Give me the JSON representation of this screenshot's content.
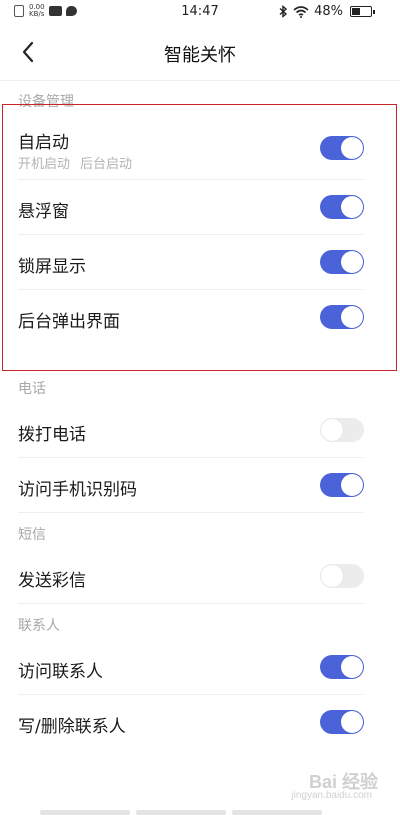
{
  "status_bar": {
    "speed_value": "0.00",
    "speed_unit": "KB/s",
    "time": "14:47",
    "battery_percent": "48%",
    "battery_level": 0.48
  },
  "header": {
    "title": "智能关怀"
  },
  "sections": [
    {
      "title": "设备管理",
      "items": [
        {
          "label": "自启动",
          "sub": [
            "开机启动",
            "后台启动"
          ],
          "enabled": true
        },
        {
          "label": "悬浮窗",
          "enabled": true
        },
        {
          "label": "锁屏显示",
          "enabled": true
        },
        {
          "label": "后台弹出界面",
          "enabled": true
        }
      ]
    },
    {
      "title": "电话",
      "items": [
        {
          "label": "拨打电话",
          "enabled": false
        },
        {
          "label": "访问手机识别码",
          "enabled": true
        }
      ]
    },
    {
      "title": "短信",
      "items": [
        {
          "label": "发送彩信",
          "enabled": false
        }
      ]
    },
    {
      "title": "联系人",
      "items": [
        {
          "label": "访问联系人",
          "enabled": true
        },
        {
          "label": "写/删除联系人",
          "enabled": true
        }
      ]
    }
  ],
  "watermark": {
    "text": "Bai 经验",
    "sub": "jingyan.baidu.com"
  },
  "colors": {
    "toggle_on": "#4a63d9",
    "toggle_off": "#ececec",
    "highlight": "#c6262b"
  }
}
